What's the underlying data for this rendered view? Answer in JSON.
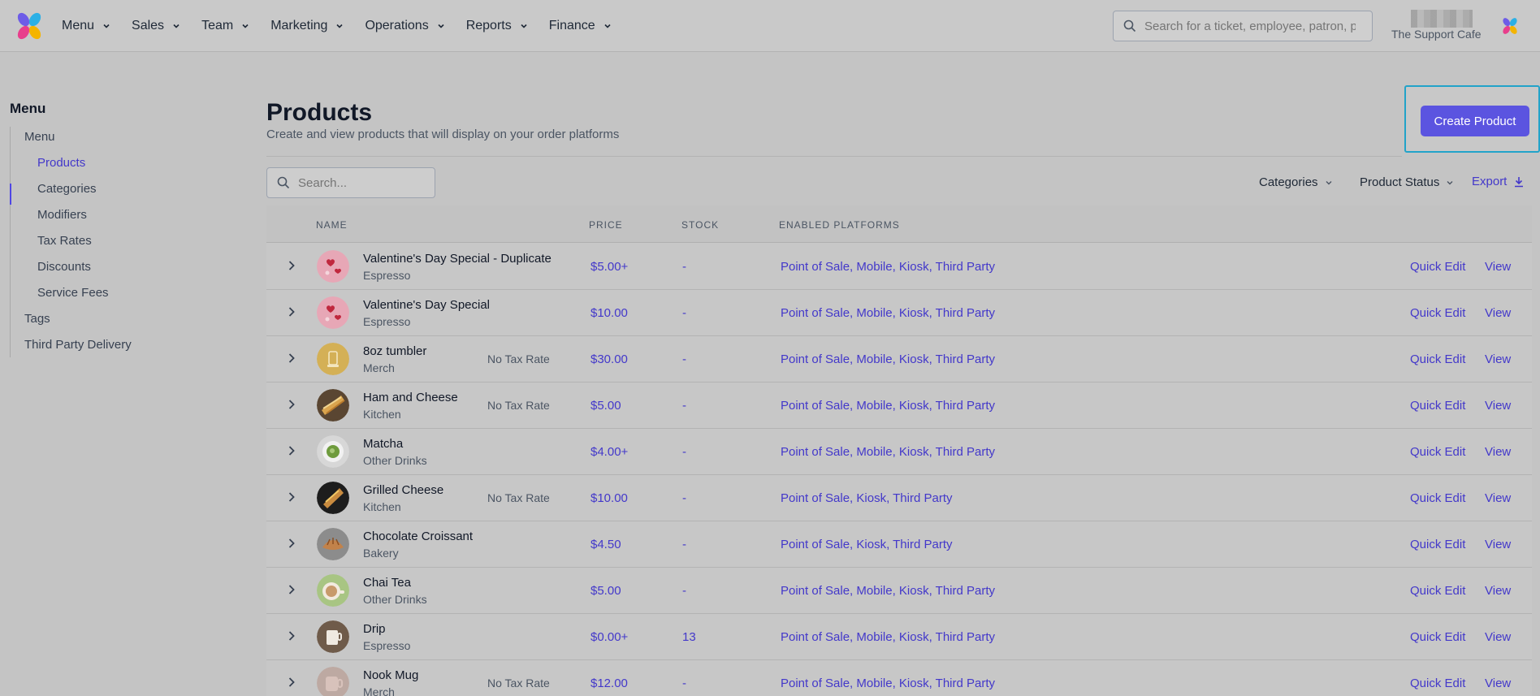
{
  "nav": {
    "items": [
      {
        "label": "Menu"
      },
      {
        "label": "Sales"
      },
      {
        "label": "Team"
      },
      {
        "label": "Marketing"
      },
      {
        "label": "Operations"
      },
      {
        "label": "Reports"
      },
      {
        "label": "Finance"
      }
    ],
    "search_placeholder": "Search for a ticket, employee, patron, p",
    "org_name": "The Support Cafe"
  },
  "sidebar": {
    "title": "Menu",
    "items": [
      {
        "label": "Menu"
      },
      {
        "label": "Products"
      },
      {
        "label": "Categories"
      },
      {
        "label": "Modifiers"
      },
      {
        "label": "Tax Rates"
      },
      {
        "label": "Discounts"
      },
      {
        "label": "Service Fees"
      },
      {
        "label": "Tags"
      },
      {
        "label": "Third Party Delivery"
      }
    ]
  },
  "main": {
    "title": "Products",
    "subtitle": "Create and view products that will display on your order platforms",
    "create_label": "Create Product",
    "search_placeholder": "Search...",
    "filter_categories": "Categories",
    "filter_status": "Product Status",
    "export_label": "Export"
  },
  "table": {
    "headers": {
      "name": "NAME",
      "price": "PRICE",
      "stock": "STOCK",
      "platforms": "ENABLED PLATFORMS"
    },
    "quick_edit_label": "Quick Edit",
    "view_label": "View",
    "rows": [
      {
        "name": "Valentine's Day Special - Duplicate",
        "category": "Espresso",
        "tax": "",
        "price": "$5.00+",
        "stock": "-",
        "platforms": "Point of Sale, Mobile, Kiosk, Third Party",
        "thumb": "valentine"
      },
      {
        "name": "Valentine's Day Special",
        "category": "Espresso",
        "tax": "",
        "price": "$10.00",
        "stock": "-",
        "platforms": "Point of Sale, Mobile, Kiosk, Third Party",
        "thumb": "valentine"
      },
      {
        "name": "8oz tumbler",
        "category": "Merch",
        "tax": "No Tax Rate",
        "price": "$30.00",
        "stock": "-",
        "platforms": "Point of Sale, Mobile, Kiosk, Third Party",
        "thumb": "tumbler"
      },
      {
        "name": "Ham and Cheese",
        "category": "Kitchen",
        "tax": "No Tax Rate",
        "price": "$5.00",
        "stock": "-",
        "platforms": "Point of Sale, Mobile, Kiosk, Third Party",
        "thumb": "sandwich"
      },
      {
        "name": "Matcha",
        "category": "Other Drinks",
        "tax": "",
        "price": "$4.00+",
        "stock": "-",
        "platforms": "Point of Sale, Mobile, Kiosk, Third Party",
        "thumb": "matcha"
      },
      {
        "name": "Grilled Cheese",
        "category": "Kitchen",
        "tax": "No Tax Rate",
        "price": "$10.00",
        "stock": "-",
        "platforms": "Point of Sale, Kiosk, Third Party",
        "thumb": "grilled"
      },
      {
        "name": "Chocolate Croissant",
        "category": "Bakery",
        "tax": "",
        "price": "$4.50",
        "stock": "-",
        "platforms": "Point of Sale, Kiosk, Third Party",
        "thumb": "croissant"
      },
      {
        "name": "Chai Tea",
        "category": "Other Drinks",
        "tax": "",
        "price": "$5.00",
        "stock": "-",
        "platforms": "Point of Sale, Mobile, Kiosk, Third Party",
        "thumb": "chai"
      },
      {
        "name": "Drip",
        "category": "Espresso",
        "tax": "",
        "price": "$0.00+",
        "stock": "13",
        "platforms": "Point of Sale, Mobile, Kiosk, Third Party",
        "thumb": "drip"
      },
      {
        "name": "Nook Mug",
        "category": "Merch",
        "tax": "No Tax Rate",
        "price": "$12.00",
        "stock": "-",
        "platforms": "Point of Sale, Mobile, Kiosk, Third Party",
        "thumb": "mug"
      }
    ]
  }
}
